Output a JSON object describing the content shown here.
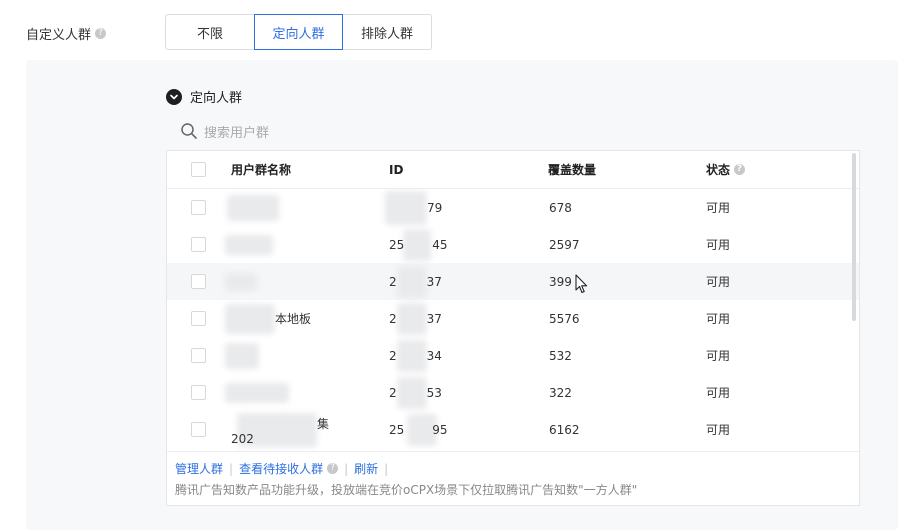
{
  "field": {
    "label": "自定义人群",
    "help_icon": "question-circle-icon"
  },
  "segmented": {
    "options": [
      "不限",
      "定向人群",
      "排除人群"
    ],
    "selected": "定向人群"
  },
  "section": {
    "title": "定向人群",
    "toggle_icon": "chevron-down-circle-icon"
  },
  "search": {
    "placeholder": "搜索用户群",
    "icon": "search-icon",
    "value": ""
  },
  "table": {
    "headers": {
      "name": "用户群名称",
      "id": "ID",
      "count": "覆盖数量",
      "status": "状态"
    },
    "rows": [
      {
        "name": "",
        "id": "79",
        "count": "678",
        "status": "可用"
      },
      {
        "name": "",
        "id": "25 45",
        "count": "2597",
        "status": "可用"
      },
      {
        "name": "",
        "id": "2 37",
        "count": "399",
        "status": "可用"
      },
      {
        "name": "本地板",
        "id": "2 37",
        "count": "5576",
        "status": "可用"
      },
      {
        "name": "",
        "id": "2 34",
        "count": "532",
        "status": "可用"
      },
      {
        "name": "",
        "id": "2 53",
        "count": "322",
        "status": "可用"
      },
      {
        "name": "集",
        "name_line2": "202",
        "id": "25 95",
        "count": "6162",
        "status": "可用"
      }
    ]
  },
  "footer": {
    "links": [
      "管理人群",
      "查看待接收人群",
      "刷新"
    ],
    "note": "腾讯广告知数产品功能升级，投放端在竞价oCPX场景下仅拉取腾讯广告知数\"一方人群\""
  },
  "colors": {
    "accent": "#2d6fe0",
    "border": "#dcdcdc",
    "panel_bg": "#f7f8fa"
  }
}
